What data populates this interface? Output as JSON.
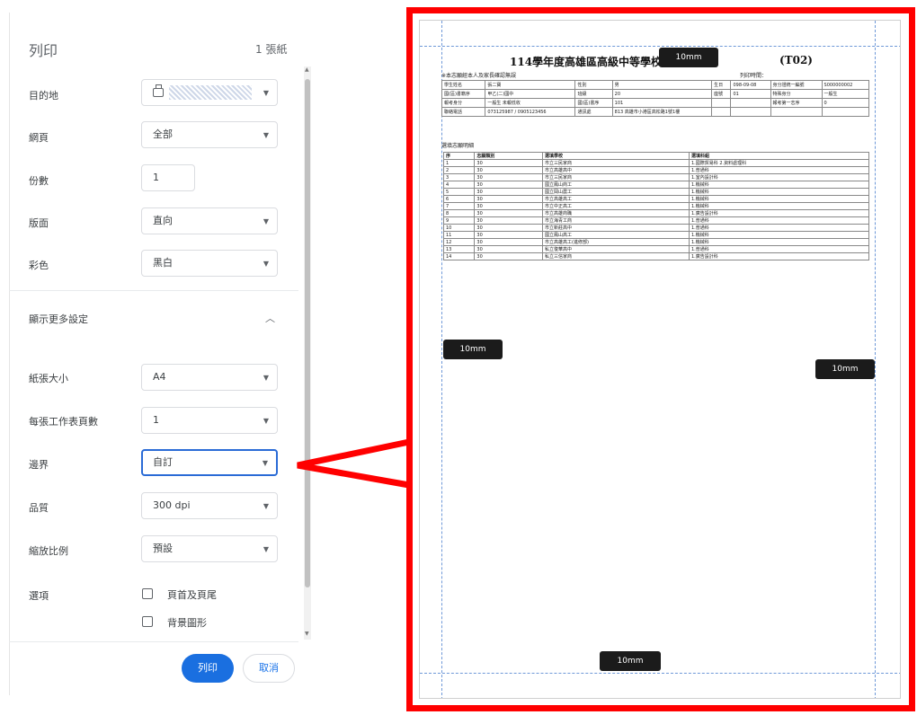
{
  "panel": {
    "title": "列印",
    "page_count": "1 張紙",
    "destination": {
      "label": "目的地"
    },
    "pages": {
      "label": "網頁",
      "value": "全部"
    },
    "copies": {
      "label": "份數",
      "value": "1"
    },
    "layout": {
      "label": "版面",
      "value": "直向"
    },
    "color": {
      "label": "彩色",
      "value": "黑白"
    },
    "more_settings": {
      "label": "顯示更多設定"
    },
    "paper_size": {
      "label": "紙張大小",
      "value": "A4"
    },
    "pages_per_sheet": {
      "label": "每張工作表頁數",
      "value": "1"
    },
    "margins": {
      "label": "邊界",
      "value": "自訂"
    },
    "quality": {
      "label": "品質",
      "value": "300 dpi"
    },
    "scale": {
      "label": "縮放比例",
      "value": "預設"
    },
    "options": {
      "label": "選項",
      "headers_footers": "頁首及頁尾",
      "background_graphics": "背景圖形"
    },
    "buttons": {
      "print": "列印",
      "cancel": "取消"
    }
  },
  "preview": {
    "title": "114學年度高雄區高級中等學校免",
    "title_code": "(T02)",
    "subtitle": "※本志願經本人及家長確認無誤",
    "print_time_label": "列印時間：",
    "info_rows": [
      [
        "學生姓名",
        "張二寶",
        "性別",
        "男",
        "生日",
        "098-09-08",
        "身分證統一編號",
        "S000000002"
      ],
      [
        "國(區)書籍序",
        "甲乙(二)國中",
        "班級",
        "20",
        "座號",
        "01",
        "特殊身分",
        "一般生"
      ],
      [
        "報考身分",
        "一般生 未報低收",
        "國(區)書序",
        "101",
        "",
        "",
        "報考第一志序",
        "0"
      ],
      [
        "聯絡電話",
        "073125987 / 0905123456",
        "通訊處",
        "813 高雄市小港區高松路1號1樓",
        "",
        "",
        "",
        ""
      ]
    ],
    "volunteer_title": "選填志願明細",
    "volunteer_headers": [
      "序",
      "志願類別",
      "選填學校",
      "選填科組"
    ],
    "volunteers": [
      [
        "1",
        "30",
        "市立三民家商",
        "1.國際貿易科 2.資料處理科"
      ],
      [
        "2",
        "30",
        "市立高雄高中",
        "1.普通科"
      ],
      [
        "3",
        "30",
        "市立三民家商",
        "1.室內設計科"
      ],
      [
        "4",
        "30",
        "國立鳳山商工",
        "1.機械科"
      ],
      [
        "5",
        "30",
        "國立岡山農工",
        "1.機械科"
      ],
      [
        "6",
        "30",
        "市立高雄高工",
        "1.機械科"
      ],
      [
        "7",
        "30",
        "市立中正高工",
        "1.機械科"
      ],
      [
        "8",
        "30",
        "市立高雄商職",
        "1.廣告設計科"
      ],
      [
        "9",
        "30",
        "市立海青工商",
        "1.普通科"
      ],
      [
        "10",
        "30",
        "市立新莊高中",
        "1.普通科"
      ],
      [
        "11",
        "30",
        "國立鳳山高工",
        "1.機械科"
      ],
      [
        "12",
        "30",
        "市立高雄高工(進修部)",
        "1.機械科"
      ],
      [
        "13",
        "30",
        "私立復華高中",
        "1.普通科"
      ],
      [
        "14",
        "30",
        "私立三信家商",
        "1.廣告設計科"
      ]
    ],
    "margin_tags": [
      "10mm",
      "10mm",
      "10mm",
      "10mm"
    ]
  }
}
